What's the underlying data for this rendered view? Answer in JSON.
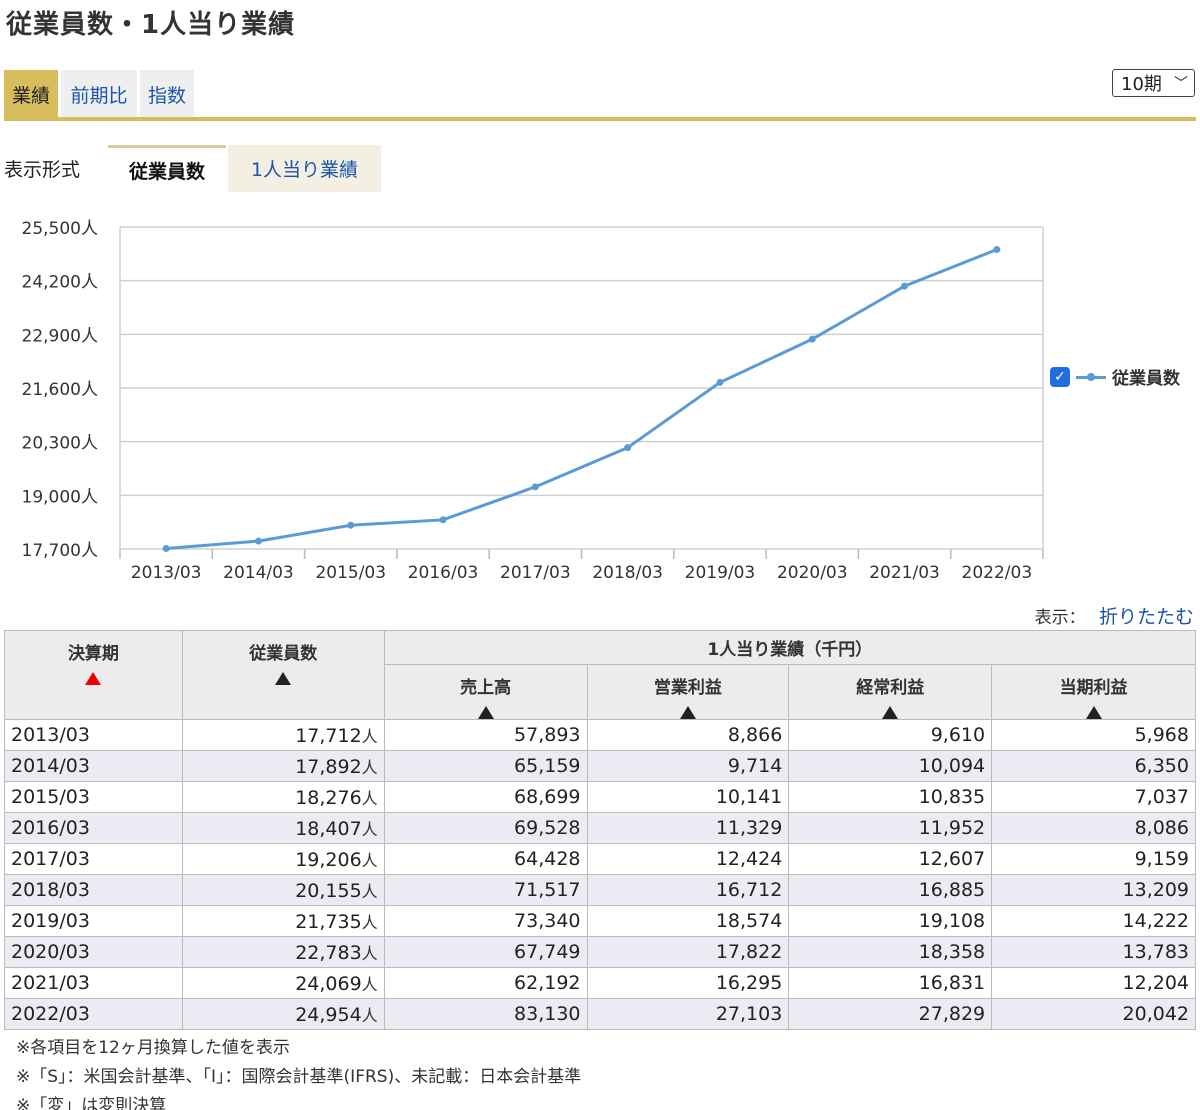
{
  "page_title": "従業員数・1人当り業績",
  "tabs": [
    {
      "label": "業績",
      "active": true
    },
    {
      "label": "前期比",
      "active": false
    },
    {
      "label": "指数",
      "active": false
    }
  ],
  "period_select": {
    "value": "10期"
  },
  "format": {
    "label": "表示形式",
    "options": [
      {
        "label": "従業員数",
        "active": true
      },
      {
        "label": "1人当り業績",
        "active": false
      }
    ]
  },
  "chart_data": {
    "type": "line",
    "categories": [
      "2013/03",
      "2014/03",
      "2015/03",
      "2016/03",
      "2017/03",
      "2018/03",
      "2019/03",
      "2020/03",
      "2021/03",
      "2022/03"
    ],
    "series": [
      {
        "name": "従業員数",
        "values": [
          17712,
          17892,
          18276,
          18407,
          19206,
          20155,
          21735,
          22783,
          24069,
          24954
        ],
        "color": "#5b9bd5"
      }
    ],
    "ylim": [
      17700,
      25500
    ],
    "yticks": [
      17700,
      19000,
      20300,
      21600,
      22900,
      24200,
      25500
    ],
    "ytick_labels": [
      "17,700人",
      "19,000人",
      "20,300人",
      "21,600人",
      "22,900人",
      "24,200人",
      "25,500人"
    ],
    "grid": true,
    "legend": "right"
  },
  "display_toggle": {
    "label": "表示：",
    "link": "折りたたむ"
  },
  "table": {
    "col_period": "決算期",
    "col_employees": "従業員数",
    "group_header": "1人当り業績（千円）",
    "sub_cols": [
      "売上高",
      "営業利益",
      "経常利益",
      "当期利益"
    ],
    "employee_unit": "人",
    "rows": [
      {
        "period": "2013/03",
        "employees": "17,712",
        "sales": "57,893",
        "op": "8,866",
        "ordinary": "9,610",
        "net": "5,968"
      },
      {
        "period": "2014/03",
        "employees": "17,892",
        "sales": "65,159",
        "op": "9,714",
        "ordinary": "10,094",
        "net": "6,350"
      },
      {
        "period": "2015/03",
        "employees": "18,276",
        "sales": "68,699",
        "op": "10,141",
        "ordinary": "10,835",
        "net": "7,037"
      },
      {
        "period": "2016/03",
        "employees": "18,407",
        "sales": "69,528",
        "op": "11,329",
        "ordinary": "11,952",
        "net": "8,086"
      },
      {
        "period": "2017/03",
        "employees": "19,206",
        "sales": "64,428",
        "op": "12,424",
        "ordinary": "12,607",
        "net": "9,159"
      },
      {
        "period": "2018/03",
        "employees": "20,155",
        "sales": "71,517",
        "op": "16,712",
        "ordinary": "16,885",
        "net": "13,209"
      },
      {
        "period": "2019/03",
        "employees": "21,735",
        "sales": "73,340",
        "op": "18,574",
        "ordinary": "19,108",
        "net": "14,222"
      },
      {
        "period": "2020/03",
        "employees": "22,783",
        "sales": "67,749",
        "op": "17,822",
        "ordinary": "18,358",
        "net": "13,783"
      },
      {
        "period": "2021/03",
        "employees": "24,069",
        "sales": "62,192",
        "op": "16,295",
        "ordinary": "16,831",
        "net": "12,204"
      },
      {
        "period": "2022/03",
        "employees": "24,954",
        "sales": "83,130",
        "op": "27,103",
        "ordinary": "27,829",
        "net": "20,042"
      }
    ]
  },
  "notes": [
    "※各項目を12ヶ月換算した値を表示",
    "※「S」：米国会計基準、「I」：国際会計基準(IFRS)、未記載：日本会計基準",
    "※「変」は変則決算"
  ]
}
